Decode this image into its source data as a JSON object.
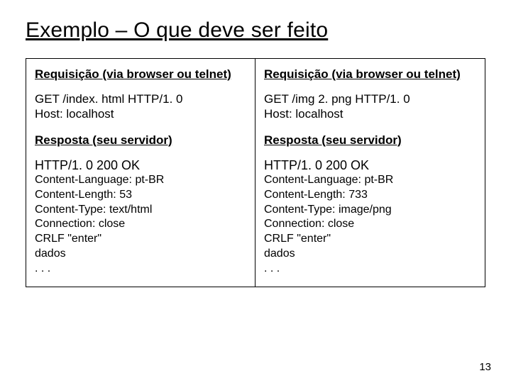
{
  "title": "Exemplo – O que deve ser feito",
  "left": {
    "req_heading": "Requisição (via browser ou telnet)",
    "req_line1": "GET /index. html HTTP/1. 0",
    "req_line2": "Host: localhost",
    "resp_heading": "Resposta (seu servidor)",
    "status": "HTTP/1. 0 200 OK",
    "h1": "Content-Language: pt-BR",
    "h2": "Content-Length: 53",
    "h3": "Content-Type: text/html",
    "h4": "Connection: close",
    "h5": "CRLF \"enter\"",
    "h6": "dados",
    "h7": ". . ."
  },
  "right": {
    "req_heading": "Requisição (via browser ou telnet)",
    "req_line1": "GET /img 2. png HTTP/1. 0",
    "req_line2": "Host: localhost",
    "resp_heading": "Resposta (seu servidor)",
    "status": "HTTP/1. 0 200 OK",
    "h1": "Content-Language: pt-BR",
    "h2": "Content-Length: 733",
    "h3": "Content-Type: image/png",
    "h4": "Connection: close",
    "h5": "CRLF \"enter\"",
    "h6": "dados",
    "h7": ". . ."
  },
  "page_number": "13"
}
